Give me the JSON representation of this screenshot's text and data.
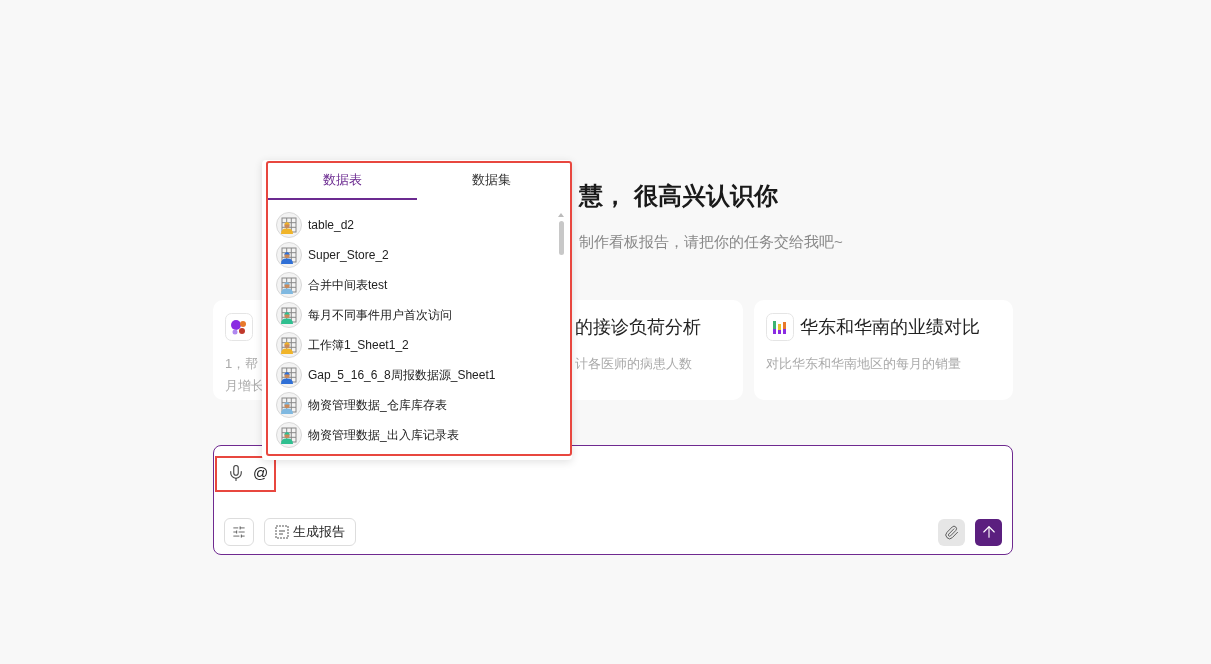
{
  "greeting": {
    "title": "慧， 很高兴认识你",
    "subtitle": "制作看板报告，请把你的任务交给我吧~"
  },
  "cards": [
    {
      "kind": "bubbles",
      "description_lines": [
        "1，帮",
        "月增长"
      ]
    },
    {
      "kind": "none",
      "title_visible": "的接诊负荷分析",
      "description_lines": [
        "计各医师的病患人数"
      ]
    },
    {
      "kind": "bars",
      "title_visible": "华东和华南的业绩对比",
      "description_lines": [
        "对比华东和华南地区的每月的销量"
      ]
    }
  ],
  "popover": {
    "tabs": [
      {
        "label": "数据表",
        "selected": true
      },
      {
        "label": "数据集",
        "selected": false
      }
    ],
    "items": [
      {
        "name": "table_d2",
        "color": "#f0b429"
      },
      {
        "name": "Super_Store_2",
        "color": "#2f6fd6"
      },
      {
        "name": "合并中间表test",
        "color": "#7fb8e0"
      },
      {
        "name": "每月不同事件用户首次访问",
        "color": "#2fbf8f"
      },
      {
        "name": "工作簿1_Sheet1_2",
        "color": "#f0b429"
      },
      {
        "name": "Gap_5_16_6_8周报数据源_Sheet1",
        "color": "#2f6fd6"
      },
      {
        "name": "物资管理数据_仓库库存表",
        "color": "#7fb8e0"
      },
      {
        "name": "物资管理数据_出入库记录表",
        "color": "#2fbf8f"
      }
    ]
  },
  "composer": {
    "value": "@",
    "report_button": "生成报告"
  }
}
